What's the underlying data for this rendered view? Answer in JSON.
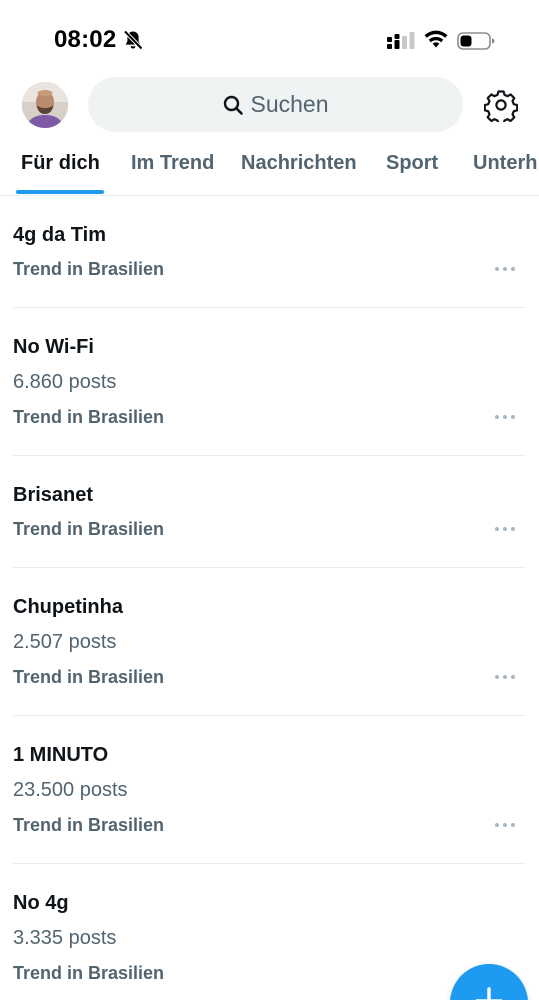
{
  "status_bar": {
    "time": "08:02"
  },
  "search": {
    "placeholder": "Suchen"
  },
  "tabs": [
    {
      "label": "Für dich",
      "active": true
    },
    {
      "label": "Im Trend",
      "active": false
    },
    {
      "label": "Nachrichten",
      "active": false
    },
    {
      "label": "Sport",
      "active": false
    },
    {
      "label": "Unterh",
      "active": false
    }
  ],
  "trends": [
    {
      "name": "4g da Tim",
      "posts": "",
      "context": "Trend in Brasilien"
    },
    {
      "name": "No Wi-Fi",
      "posts": "6.860 posts",
      "context": "Trend in Brasilien"
    },
    {
      "name": "Brisanet",
      "posts": "",
      "context": "Trend in Brasilien"
    },
    {
      "name": "Chupetinha",
      "posts": "2.507 posts",
      "context": "Trend in Brasilien"
    },
    {
      "name": "1 MINUTO",
      "posts": "23.500 posts",
      "context": "Trend in Brasilien"
    },
    {
      "name": "No 4g",
      "posts": "3.335 posts",
      "context": "Trend in Brasilien"
    }
  ],
  "colors": {
    "accent": "#1d9bf0",
    "text_primary": "#0f1419",
    "text_secondary": "#536471",
    "search_bg": "#eff3f4"
  },
  "icons": {
    "bell": "bell-slash-icon",
    "signal": "cellular-signal-icon",
    "wifi": "wifi-icon",
    "battery": "battery-icon",
    "search": "search-icon",
    "settings": "gear-icon",
    "more": "more-horizontal-icon",
    "compose": "plus-icon"
  }
}
